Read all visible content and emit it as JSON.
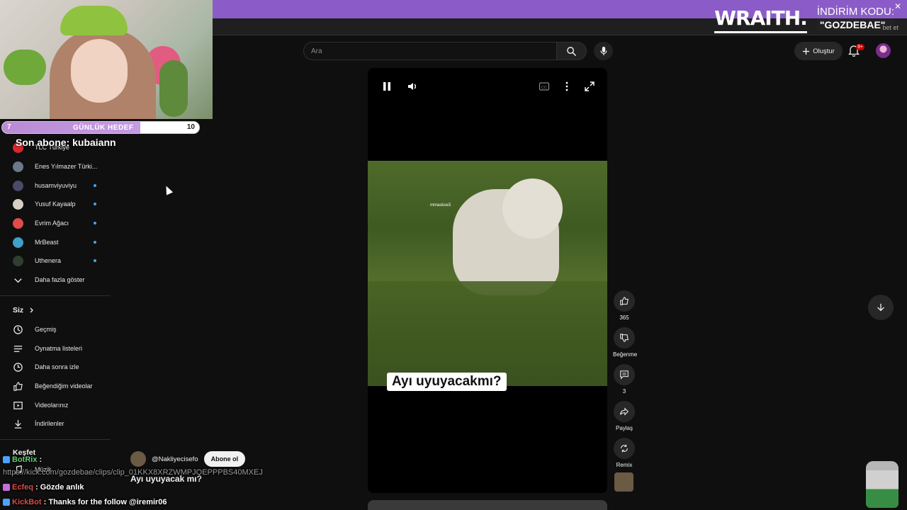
{
  "banner": {
    "brand": "WRAITH.",
    "promo_line1": "İNDİRİM KODU:",
    "promo_code": "\"GOZDEBAE\"",
    "close": "✕",
    "tiny": "bet et"
  },
  "goal": {
    "current": "7",
    "label": "GÜNLÜK HEDEF",
    "target": "10",
    "progress_fraction": 0.7
  },
  "last_sub": "Son abone: kubaiann",
  "subscriptions": [
    {
      "name": "TLC Türkiye",
      "color": "#d8262f",
      "dot": false
    },
    {
      "name": "Enes Yılmazer Türki...",
      "color": "#6b7a8a",
      "dot": false
    },
    {
      "name": "husamviyuviyu",
      "color": "#4a4a6a",
      "dot": true
    },
    {
      "name": "Yusuf Kayaalp",
      "color": "#d6cfc4",
      "dot": true
    },
    {
      "name": "Evrim Ağacı",
      "color": "#e34a4a",
      "dot": true
    },
    {
      "name": "MrBeast",
      "color": "#3fa0c8",
      "dot": true
    },
    {
      "name": "Uthenera",
      "color": "#2f3f2f",
      "dot": true
    }
  ],
  "show_more": "Daha fazla göster",
  "you_section": {
    "heading": "Siz",
    "items": [
      {
        "label": "Geçmiş",
        "icon": "history-icon"
      },
      {
        "label": "Oynatma listeleri",
        "icon": "playlist-icon"
      },
      {
        "label": "Daha sonra izle",
        "icon": "watch-later-icon"
      },
      {
        "label": "Beğendiğim videolar",
        "icon": "like-icon"
      },
      {
        "label": "Videolarınız",
        "icon": "your-videos-icon"
      },
      {
        "label": "İndirilenler",
        "icon": "download-icon"
      }
    ]
  },
  "explore": {
    "heading": "Keşfet",
    "music": "Müzik"
  },
  "search": {
    "placeholder": "Ara"
  },
  "header": {
    "create_label": "Oluştur",
    "notif_badge": "9+"
  },
  "short": {
    "watermark": "mmaskse3",
    "caption": "Ayı uyuyacakmı?"
  },
  "actions": {
    "like_count": "365",
    "dislike_label": "Beğenme",
    "comment_count": "3",
    "share_label": "Paylaş",
    "remix_label": "Remix"
  },
  "channel": {
    "name": "@Nakliyecisefo",
    "subscribe_label": "Abone ol",
    "title": "Ayı uyuyacak mı?"
  },
  "chat": [
    {
      "user": "BotRix",
      "sep": " :",
      "text": ""
    },
    {
      "user": "",
      "sep": "",
      "text": "https://kick.com/gozdebae/clips/clip_01KKX8XRZWMPJQEPPPBS40MXEJ"
    },
    {
      "user": "Ecfeq",
      "sep": " : ",
      "text": "Gözde anlık"
    },
    {
      "user": "KickBot",
      "sep": " : ",
      "text": "Thanks for the follow @iremir06"
    }
  ]
}
